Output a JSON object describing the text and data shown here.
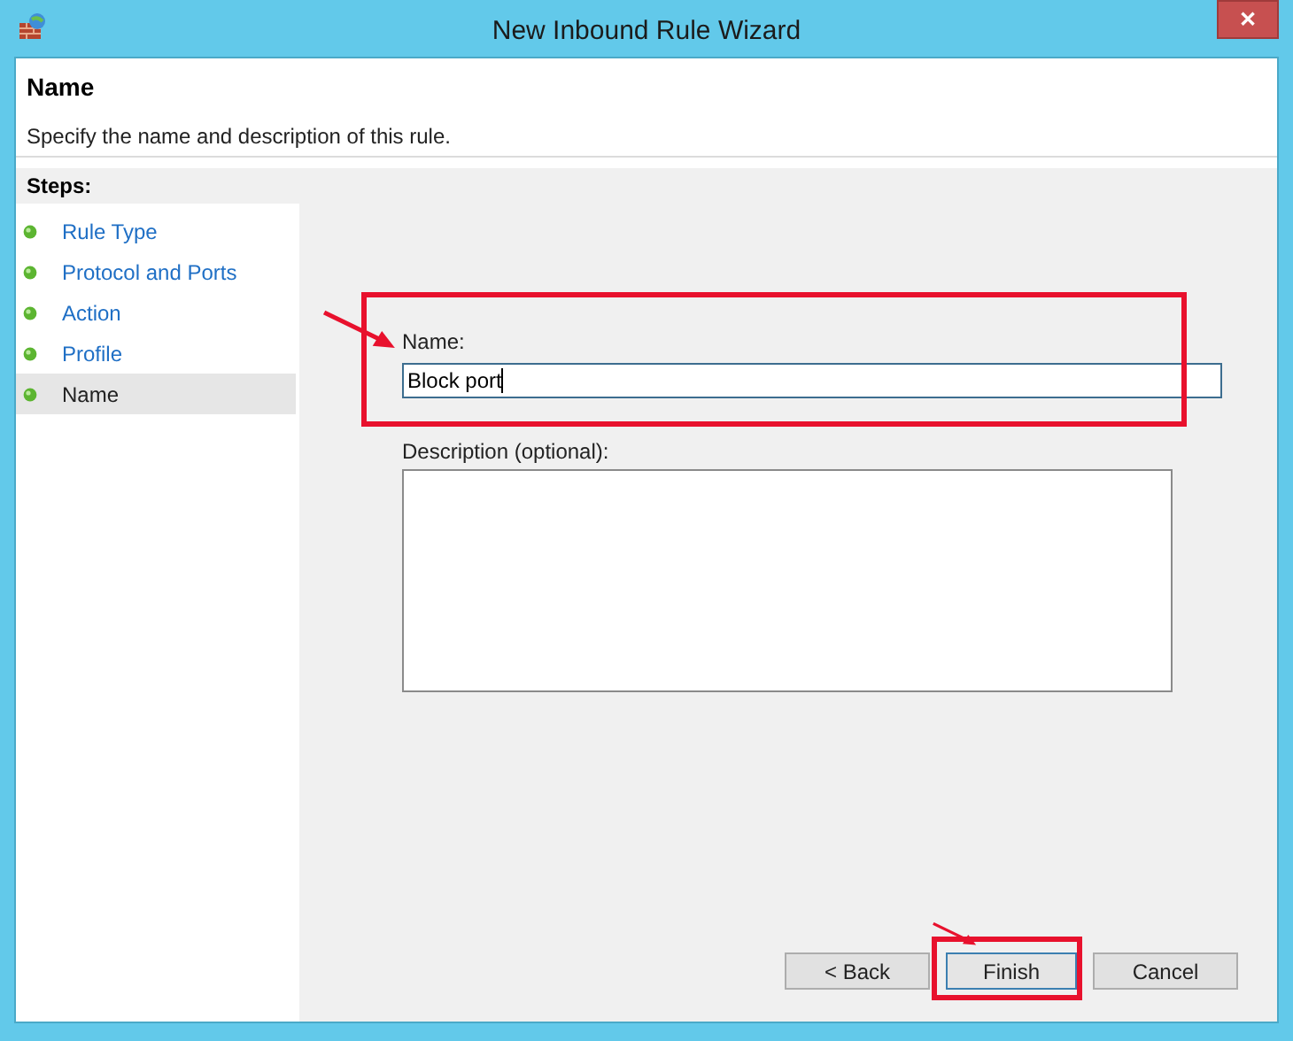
{
  "window": {
    "title": "New Inbound Rule Wizard",
    "close": "✕"
  },
  "header": {
    "title": "Name",
    "subtitle": "Specify the name and description of this rule."
  },
  "steps": {
    "heading": "Steps:",
    "items": [
      {
        "label": "Rule Type",
        "selected": false
      },
      {
        "label": "Protocol and Ports",
        "selected": false
      },
      {
        "label": "Action",
        "selected": false
      },
      {
        "label": "Profile",
        "selected": false
      },
      {
        "label": "Name",
        "selected": true
      }
    ]
  },
  "form": {
    "name_label": "Name:",
    "name_value": "Block port",
    "name_highlighted": true,
    "description_label": "Description (optional):"
  },
  "buttons": [
    {
      "label": "< Back",
      "focused": false,
      "highlighted": false
    },
    {
      "label": "Finish",
      "focused": true,
      "highlighted": true
    },
    {
      "label": "Cancel",
      "focused": false,
      "highlighted": false
    }
  ]
}
